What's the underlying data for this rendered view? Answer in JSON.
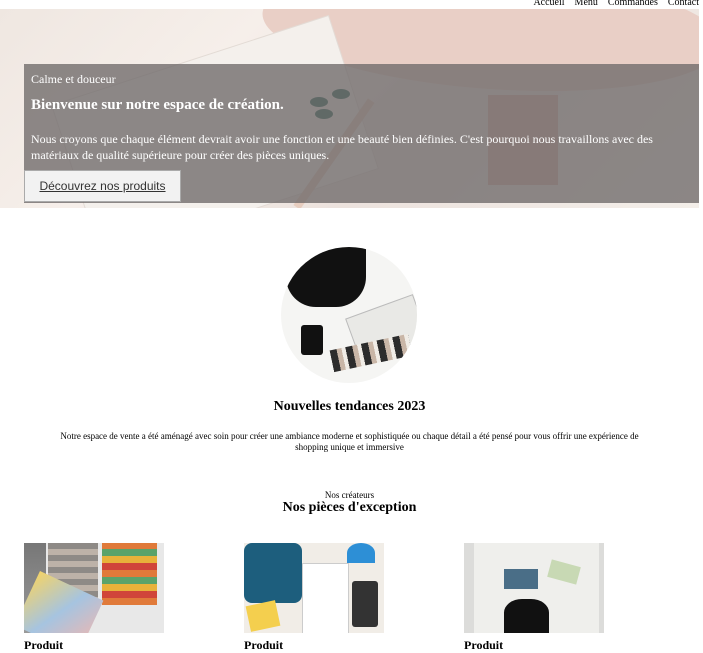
{
  "nav": {
    "items": [
      "Accueil",
      "Menu",
      "Commandes",
      "Contact"
    ]
  },
  "hero": {
    "kicker": "Calme et douceur",
    "title": "Bienvenue sur notre espace de création.",
    "text": "Nous croyons que chaque élément devrait avoir une fonction et une beauté bien définies. C'est pourquoi nous travaillons avec des matériaux de qualité supérieure pour créer des pièces uniques.",
    "cta": "Découvrez nos produits"
  },
  "trends": {
    "title": "Nouvelles tendances 2023",
    "text": "Notre espace de vente a été aménagé avec soin pour créer une ambiance moderne et sophistiquée ou chaque détail a été pensé pour vous offrir une expérience de shopping unique et immersive"
  },
  "section": {
    "kicker": "Nos créateurs",
    "title": "Nos pièces d'exception"
  },
  "products": [
    {
      "label": "Produit"
    },
    {
      "label": "Produit"
    },
    {
      "label": "Produit"
    }
  ]
}
